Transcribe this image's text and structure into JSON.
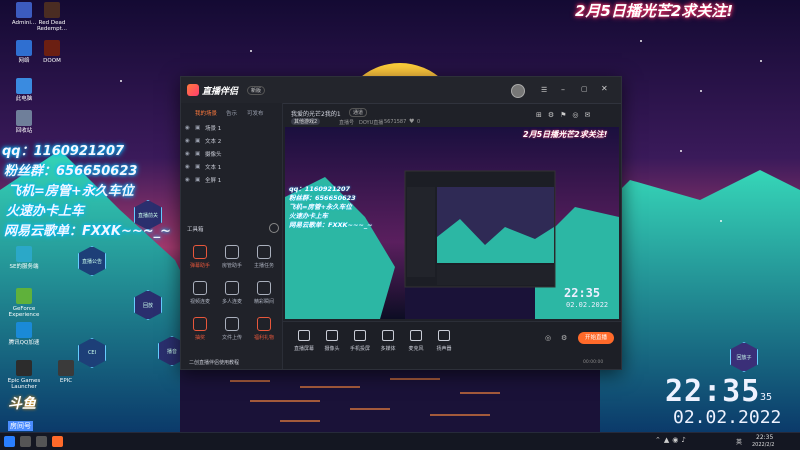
{
  "desktop": {
    "icons": [
      {
        "label": "Admini...",
        "color": "#3c5bbf"
      },
      {
        "label": "Red Dead Redempt...",
        "color": "#4a2c22"
      },
      {
        "label": "网络",
        "color": "#2f6fd1"
      },
      {
        "label": "DOOM",
        "color": "#6b1f12"
      },
      {
        "label": "此电脑",
        "color": "#3a8be0"
      },
      {
        "label": "回收站",
        "color": "#6f7f9a"
      },
      {
        "label": "SE的服务端",
        "color": "#2ba8c8"
      },
      {
        "label": "GeForce Experience",
        "color": "#5fb13b"
      },
      {
        "label": "腾讯QQ加速",
        "color": "#1a8ad8"
      },
      {
        "label": "Epic Games Launcher",
        "color": "#2c2c2c"
      },
      {
        "label": "EPIC",
        "color": "#3a3a3a"
      }
    ],
    "overlay_lines": [
      "qq：1160921207",
      "粉丝群：656650623",
      "飞机=房管+永久车位",
      "火速办卡上车",
      "网易云歌单：FXXK~~~_~"
    ],
    "top_banner": "2月5日播光芒2求关注!",
    "hexagons": [
      "直播前关",
      "直播公告",
      "回放",
      "CEI",
      "播音",
      "B站福利",
      "回放子"
    ],
    "douyu": {
      "logo": "斗鱼",
      "room_label": "房间号",
      "room_number": "5671587"
    },
    "clock": {
      "time": "22:35",
      "seconds": "35",
      "date": "02.02.2022"
    }
  },
  "app": {
    "logo": "直播伴侣",
    "version_badge": "新版",
    "title_text": "我爱的光芒2我的1",
    "tag": "通道",
    "stream_tag": "其他游戏2",
    "meta": [
      "直播号",
      "DOYU直播",
      "5671587"
    ],
    "like_count": "0",
    "left_tabs": [
      "我的场景",
      "告示",
      "可发布"
    ],
    "layers": [
      {
        "name": "场景 1"
      },
      {
        "name": "文本 2"
      },
      {
        "name": "摄像头"
      },
      {
        "name": "文本 1"
      },
      {
        "name": "全屏 1"
      }
    ],
    "tools_header": "工具箱",
    "tools": [
      {
        "label": "弹幕助手",
        "color": "#e8573b"
      },
      {
        "label": "房管助手",
        "color": "#aab0bd"
      },
      {
        "label": "主播任务",
        "color": "#aab0bd"
      },
      {
        "label": "视频连麦",
        "color": "#aab0bd"
      },
      {
        "label": "多人连麦",
        "color": "#aab0bd"
      },
      {
        "label": "精彩瞬间",
        "color": "#aab0bd"
      },
      {
        "label": "抽奖",
        "color": "#e8573b"
      },
      {
        "label": "文件上传",
        "color": "#aab0bd"
      },
      {
        "label": "福利礼物",
        "color": "#e8573b"
      }
    ],
    "notice": "二创直播伴侣使用教程",
    "preview_banner": "2月5日播光芒2求关注!",
    "preview_overlay": [
      "qq：1160921207",
      "粉丝群：656650623",
      "飞机=房管+永久车位",
      "火速办卡上车",
      "网易云歌单：FXXK~~~_~"
    ],
    "preview_clock": {
      "time": "22:35",
      "date": "02.02.2022"
    },
    "bottom_buttons": [
      "直播屏幕",
      "摄像头",
      "手机投屏",
      "多媒体",
      "麦克风",
      "扬声器"
    ],
    "start_button": "开始直播",
    "stats": "00:00:00"
  },
  "taskbar": {
    "clock": "22:35",
    "date": "2022/2/2",
    "lang": "英"
  }
}
